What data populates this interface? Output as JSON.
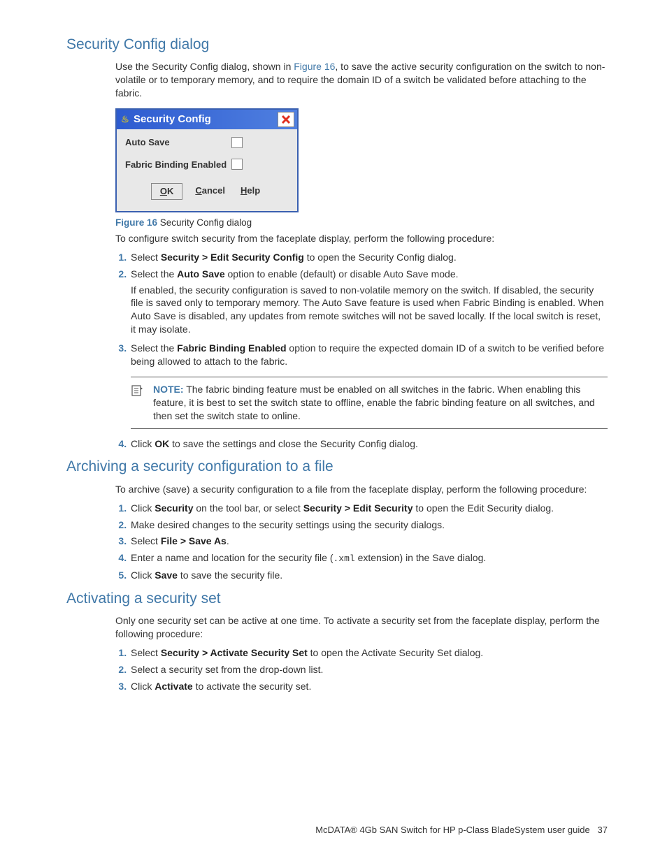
{
  "section1": {
    "title": "Security Config dialog",
    "intro_a": "Use the Security Config dialog, shown in ",
    "fig_link": "Figure 16",
    "intro_b": ", to save the active security configuration on the switch to non-volatile or to temporary memory, and to require the domain ID of a switch be validated before attaching to the fabric.",
    "dialog": {
      "title": "Security Config",
      "field1": "Auto Save",
      "field2": "Fabric Binding Enabled",
      "btn_ok": "K",
      "btn_ok_u": "O",
      "btn_cancel_u": "C",
      "btn_cancel": "ancel",
      "btn_help_u": "H",
      "btn_help": "elp"
    },
    "fig_caption_num": "Figure 16",
    "fig_caption_text": " Security Config dialog",
    "proc_intro": "To configure switch security from the faceplate display, perform the following procedure:",
    "step1_a": "Select ",
    "step1_b": "Security > Edit Security Config",
    "step1_c": " to open the Security Config dialog.",
    "step2_a": "Select the ",
    "step2_b": "Auto Save",
    "step2_c": " option to enable (default) or disable Auto Save mode.",
    "step2_p": "If enabled, the security configuration is saved to non-volatile memory on the switch. If disabled, the security file is saved only to temporary memory. The Auto Save feature is used when Fabric Binding is enabled. When Auto Save is disabled, any updates from remote switches will not be saved locally. If the local switch is reset, it may isolate.",
    "step3_a": "Select the ",
    "step3_b": "Fabric Binding Enabled",
    "step3_c": " option to require the expected domain ID of a switch to be verified before being allowed to attach to the fabric.",
    "note_label": "NOTE:",
    "note_text": " The fabric binding feature must be enabled on all switches in the fabric. When enabling this feature, it is best to set the switch state to offline, enable the fabric binding feature on all switches, and then set the switch state to online.",
    "step4_a": "Click ",
    "step4_b": "OK",
    "step4_c": " to save the settings and close the Security Config dialog."
  },
  "section2": {
    "title": "Archiving a security configuration to a file",
    "intro": "To archive (save) a security configuration to a file from the faceplate display, perform the following procedure:",
    "step1_a": "Click ",
    "step1_b": "Security",
    "step1_c": " on the tool bar, or select ",
    "step1_d": "Security > Edit Security",
    "step1_e": " to open the Edit Security dialog.",
    "step2": "Make desired changes to the security settings using the security dialogs.",
    "step3_a": "Select ",
    "step3_b": "File > Save As",
    "step3_c": ".",
    "step4_a": "Enter a name and location for the security file (",
    "step4_code": ".xml",
    "step4_b": " extension) in the Save dialog.",
    "step5_a": "Click ",
    "step5_b": "Save",
    "step5_c": " to save the security file."
  },
  "section3": {
    "title": "Activating a security set",
    "intro": "Only one security set can be active at one time. To activate a security set from the faceplate display, perform the following procedure:",
    "step1_a": "Select ",
    "step1_b": "Security > Activate Security Set",
    "step1_c": " to open the Activate Security Set dialog.",
    "step2": "Select a security set from the drop-down list.",
    "step3_a": "Click ",
    "step3_b": "Activate",
    "step3_c": " to activate the security set."
  },
  "footer": {
    "text": "McDATA® 4Gb SAN Switch for HP p-Class BladeSystem user guide",
    "page": "37"
  }
}
